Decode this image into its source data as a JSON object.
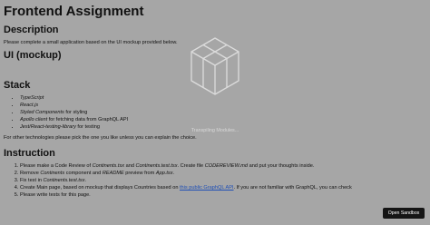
{
  "doc": {
    "title": "Frontend Assignment",
    "description_heading": "Description",
    "description_text": "Please complete a small application based on the UI mockup provided below.",
    "ui_heading": "UI (mockup)",
    "stack_heading": "Stack",
    "stack_items": [
      {
        "emph": "TypeScript",
        "rest": ""
      },
      {
        "emph": "React.js",
        "rest": ""
      },
      {
        "emph": "Styled Components",
        "rest": " for styling"
      },
      {
        "emph": "Apollo client",
        "rest": " for fetching data from GraphQL API"
      },
      {
        "emph": "Jest/React-testing-library",
        "rest": " for testing"
      }
    ],
    "other_tech_text": "For other technologies please pick the one you like unless you can explain the choice.",
    "instruction_heading": "Instruction",
    "instructions": {
      "i1": {
        "a": "Please make a Code Review of ",
        "b": "Continents.tsx",
        "c": " and ",
        "d": "Continents.test.tsx",
        "e": ". Create file ",
        "f": "CODEREVIEW.md",
        "g": " and put your thoughts inside."
      },
      "i2": {
        "a": "Remove ",
        "b": "Continents",
        "c": " component and ",
        "d": "README",
        "e": " preview from ",
        "f": "App.tsx",
        "g": "."
      },
      "i3": {
        "a": "Fix test in ",
        "b": "Continents.test.tsx",
        "c": "."
      },
      "i4": {
        "a": "Create Main page, based on mockup that displays Countries based on ",
        "link": "this public GraphQL API",
        "b": ". If you are not familiar with GraphQL, you can check"
      },
      "i5": {
        "a": "Please write tests for this page."
      }
    }
  },
  "overlay": {
    "text": "Transpiling Modules...",
    "icon": "codesandbox-cube-icon"
  },
  "sandbox_button": {
    "label": "Open Sandbox"
  },
  "colors": {
    "background": "#a6a6a6",
    "link": "#1f4fb5",
    "button_bg": "#151515"
  }
}
